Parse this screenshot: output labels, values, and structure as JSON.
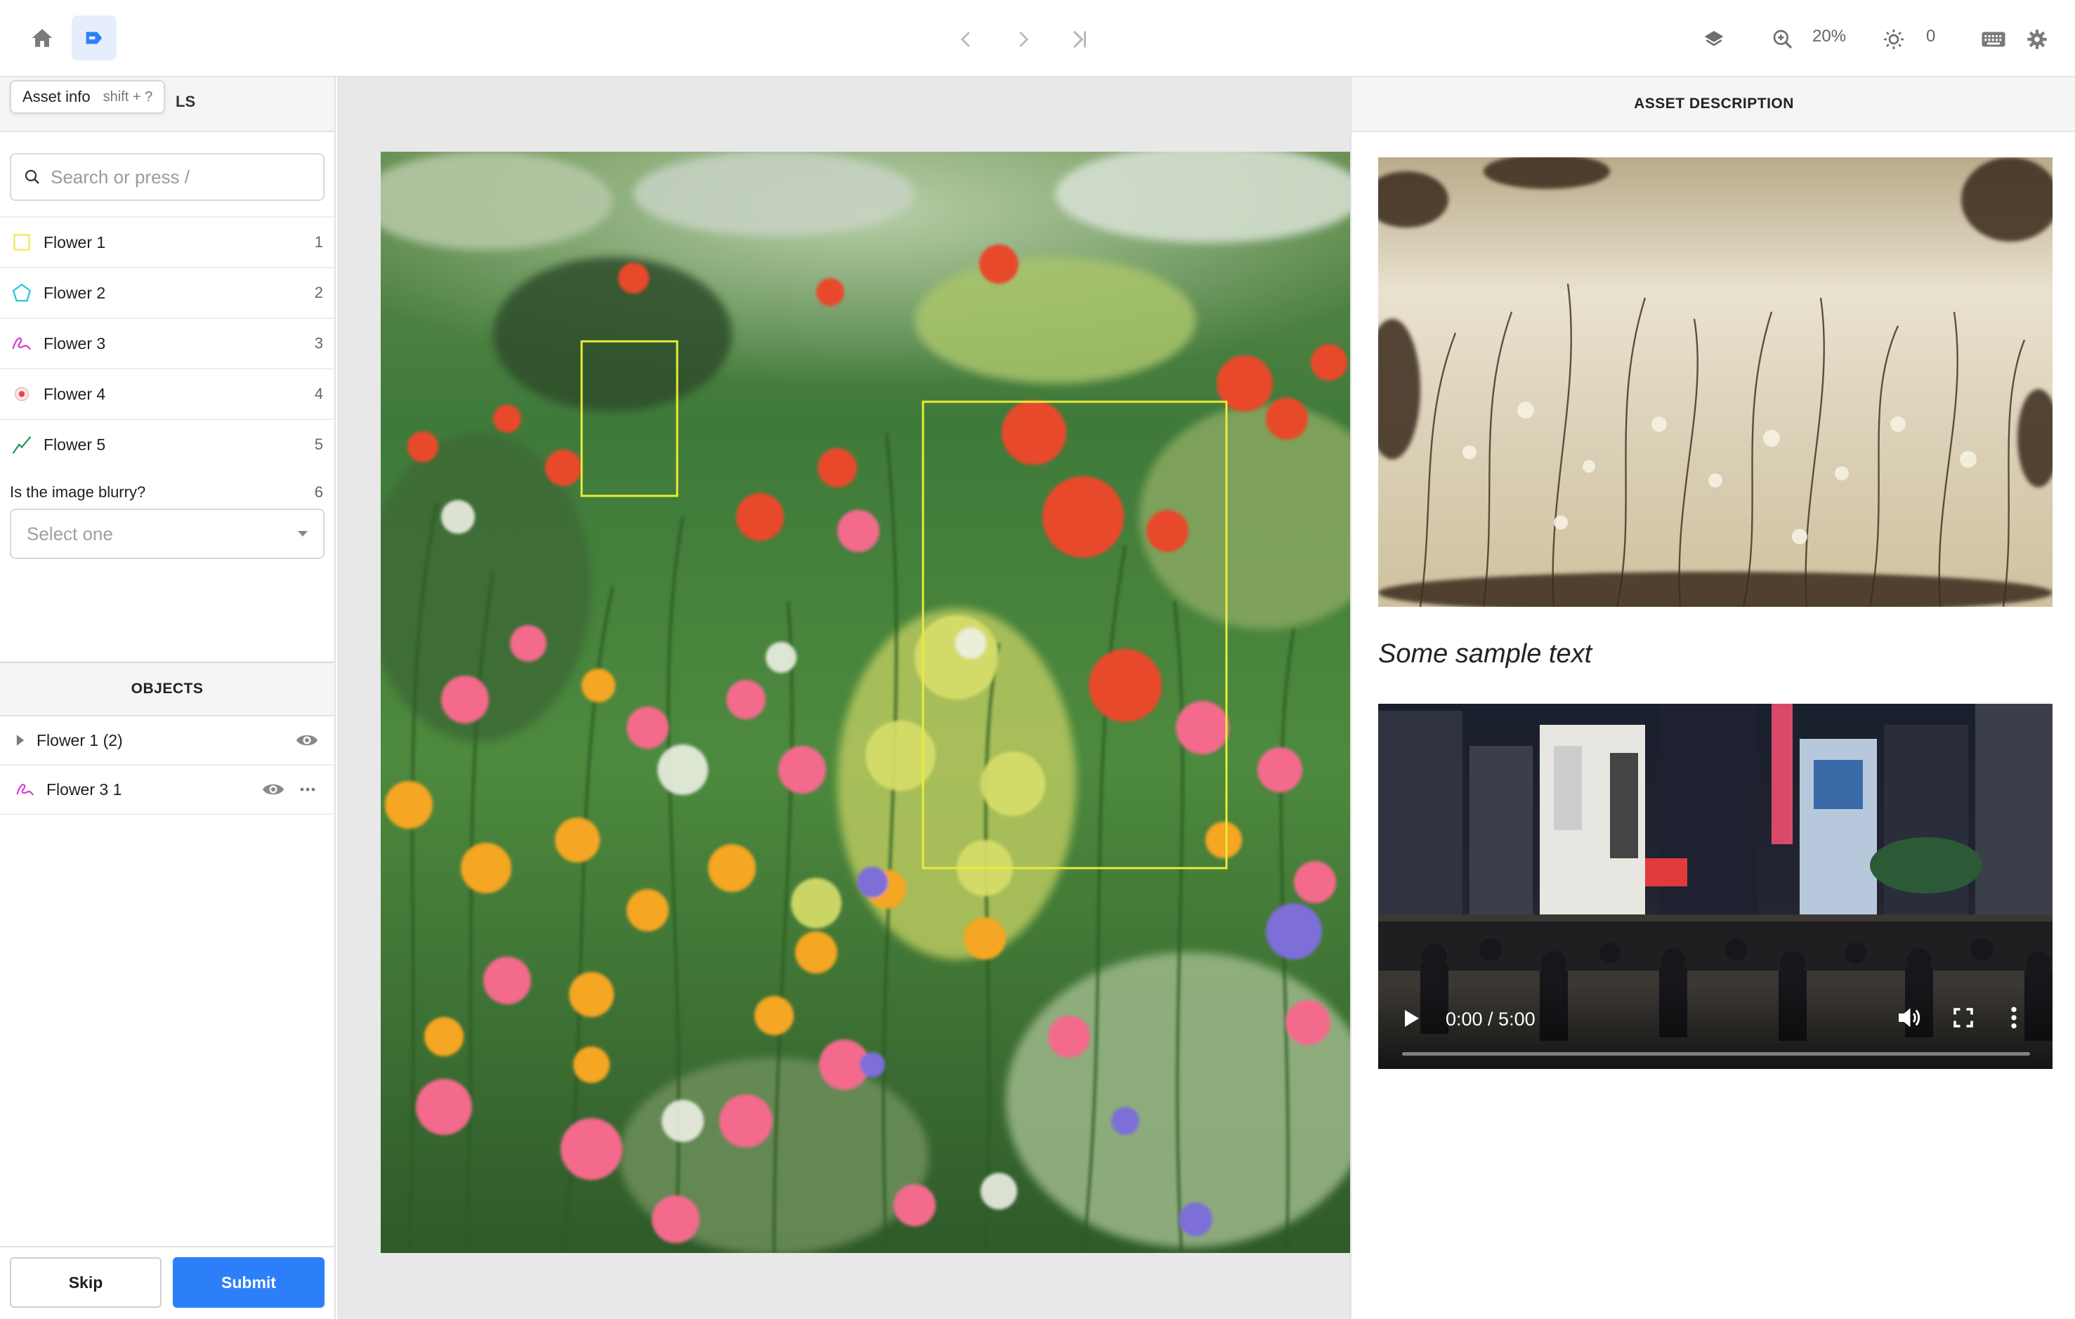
{
  "tooltip": {
    "label": "Asset info",
    "shortcut": "shift + ?",
    "header_tail": "LS"
  },
  "topbar": {
    "zoom": "20%",
    "brightness": "0"
  },
  "search": {
    "placeholder": "Search or press /"
  },
  "classes": [
    {
      "name": "Flower 1",
      "hotkey": "1",
      "tool": "bounding-box",
      "color": "#f2e85a"
    },
    {
      "name": "Flower 2",
      "hotkey": "2",
      "tool": "polygon",
      "color": "#27c4e0"
    },
    {
      "name": "Flower 3",
      "hotkey": "3",
      "tool": "freehand",
      "color": "#d63ccf"
    },
    {
      "name": "Flower 4",
      "hotkey": "4",
      "tool": "point",
      "color": "#e24a4a"
    },
    {
      "name": "Flower 5",
      "hotkey": "5",
      "tool": "polyline",
      "color": "#1d9a5a"
    }
  ],
  "question": {
    "text": "Is the image blurry?",
    "hotkey": "6",
    "placeholder": "Select one"
  },
  "objects": {
    "header": "OBJECTS",
    "items": [
      {
        "label": "Flower 1 (2)"
      },
      {
        "label": "Flower 3 1"
      }
    ]
  },
  "buttons": {
    "skip": "Skip",
    "submit": "Submit"
  },
  "right_panel": {
    "header": "ASSET DESCRIPTION",
    "sample_text": "Some sample text",
    "video_time": "0:00 / 5:00"
  },
  "annotation": {
    "box_color": "#e9ec3a"
  }
}
